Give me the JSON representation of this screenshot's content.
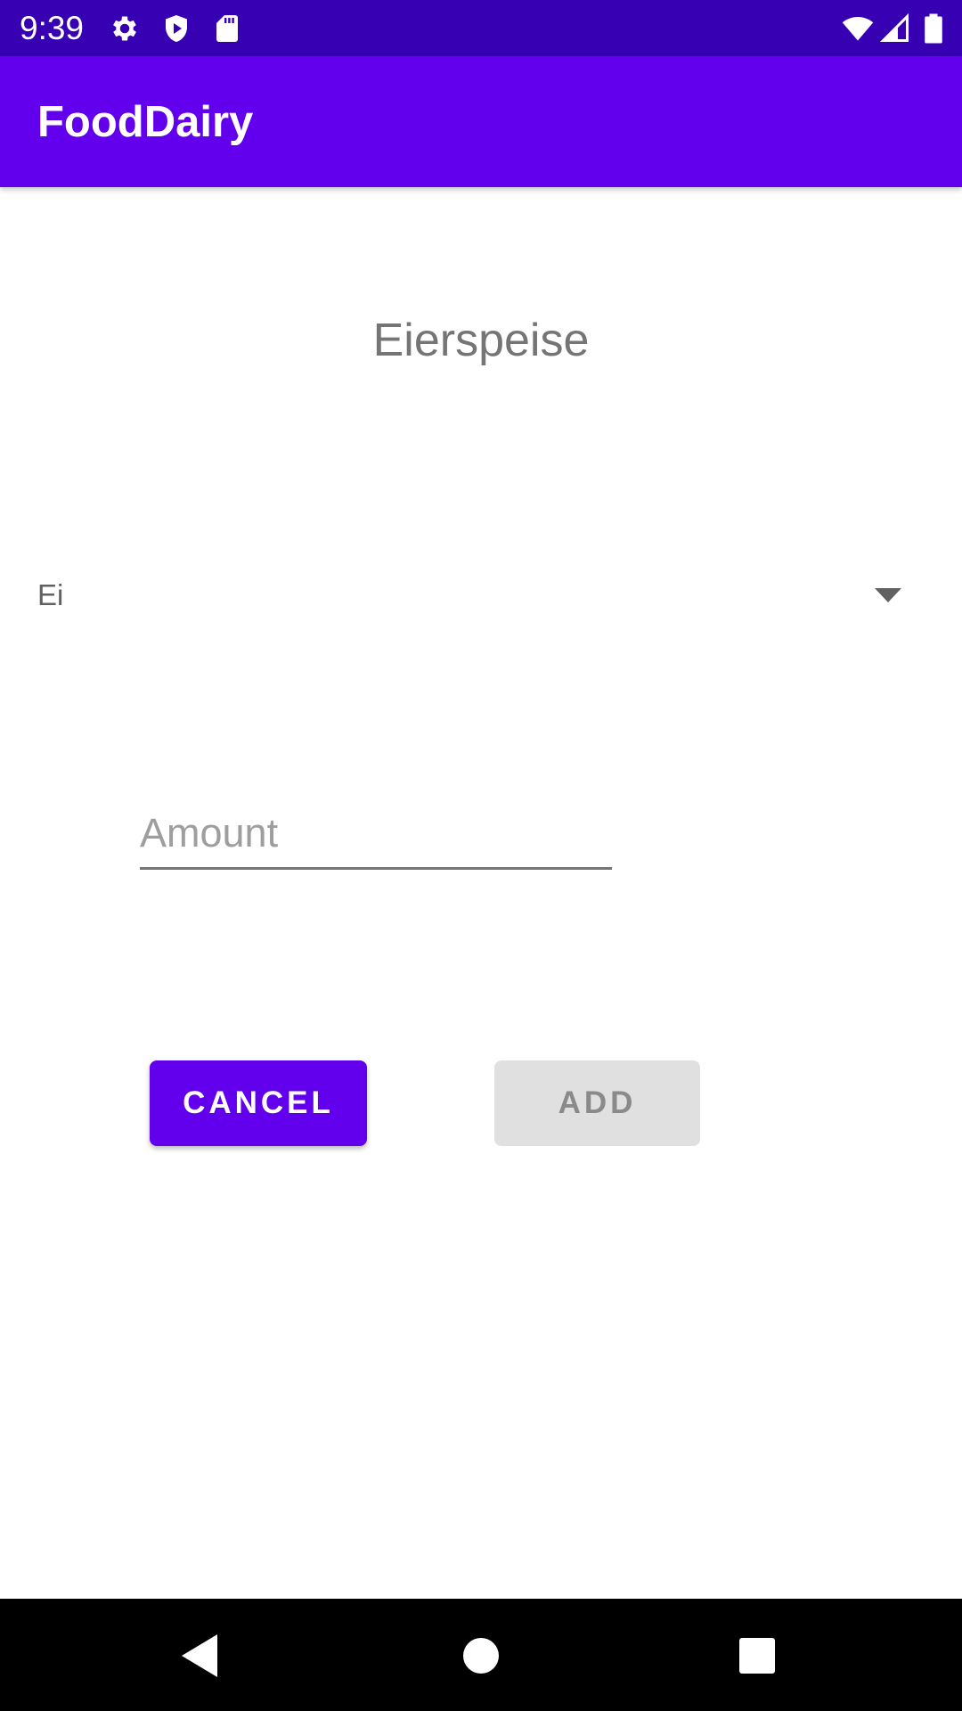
{
  "status_bar": {
    "time": "9:39",
    "icons": [
      "gear-icon",
      "shield-play-icon",
      "sd-card-icon",
      "wifi-icon",
      "signal-icon",
      "battery-icon"
    ]
  },
  "app_bar": {
    "title": "FoodDairy"
  },
  "main": {
    "recipe_title": "Eierspeise",
    "ingredient_spinner": {
      "selected": "Ei"
    },
    "amount_field": {
      "value": "",
      "placeholder": "Amount"
    },
    "cancel_label": "CANCEL",
    "add_label": "ADD"
  },
  "nav_bar": {
    "icons": [
      "back-icon",
      "home-icon",
      "recents-icon"
    ]
  },
  "colors": {
    "primary": "#6200ee",
    "primary_dark": "#3700b3",
    "disabled_button": "#e0e0e0"
  }
}
